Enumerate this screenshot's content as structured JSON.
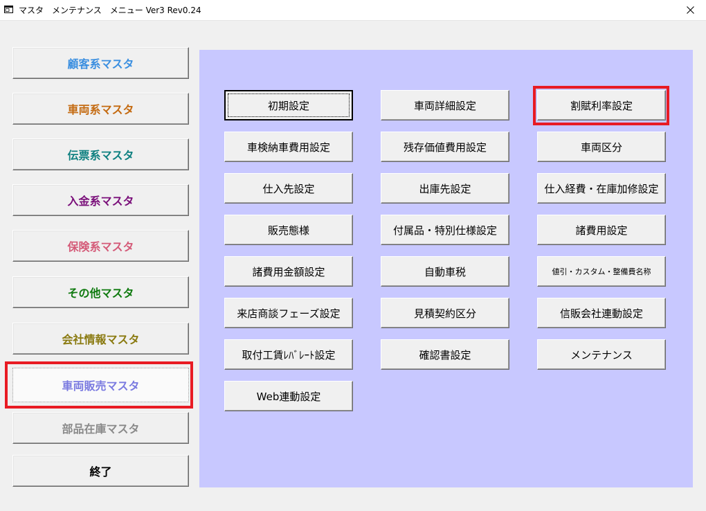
{
  "window": {
    "title": "マスタ　メンテナンス　メニュー Ver3 Rev0.24",
    "icon": "app-window-icon",
    "close_icon": "close-icon"
  },
  "left_menu": [
    {
      "id": "customer",
      "label": "顧客系マスタ",
      "color": "#3b8fe0"
    },
    {
      "id": "vehicle",
      "label": "車両系マスタ",
      "color": "#c46a10"
    },
    {
      "id": "voucher",
      "label": "伝票系マスタ",
      "color": "#0f8080"
    },
    {
      "id": "payment",
      "label": "入金系マスタ",
      "color": "#7a0f7a"
    },
    {
      "id": "insurance",
      "label": "保険系マスタ",
      "color": "#d45a78"
    },
    {
      "id": "other",
      "label": "その他マスタ",
      "color": "#0f7a0f"
    },
    {
      "id": "company",
      "label": "会社情報マスタ",
      "color": "#8a7a10"
    },
    {
      "id": "vehicle-sales",
      "label": "車両販売マスタ",
      "color": "#7a7ae0",
      "active": true
    },
    {
      "id": "parts-stock",
      "label": "部品在庫マスタ",
      "color": "#8a8a8a"
    },
    {
      "id": "exit",
      "label": "終了",
      "color": "#000000"
    }
  ],
  "grid_buttons": [
    [
      "初期設定",
      "車両詳細設定",
      "割賦利率設定"
    ],
    [
      "車検納車費用設定",
      "残存価値費用設定",
      "車両区分"
    ],
    [
      "仕入先設定",
      "出庫先設定",
      "仕入経費・在庫加修設定"
    ],
    [
      "販売態様",
      "付属品・特別仕様設定",
      "諸費用設定"
    ],
    [
      "諸費用金額設定",
      "自動車税",
      "値引・カスタム・整備費名称"
    ],
    [
      "来店商談フェーズ設定",
      "見積契約区分",
      "信販会社連動設定"
    ],
    [
      "取付工賃ﾚﾊﾞﾚｰﾄ設定",
      "確認書設定",
      "メンテナンス"
    ],
    [
      "Web連動設定"
    ]
  ],
  "highlight_color": "#e81b23"
}
